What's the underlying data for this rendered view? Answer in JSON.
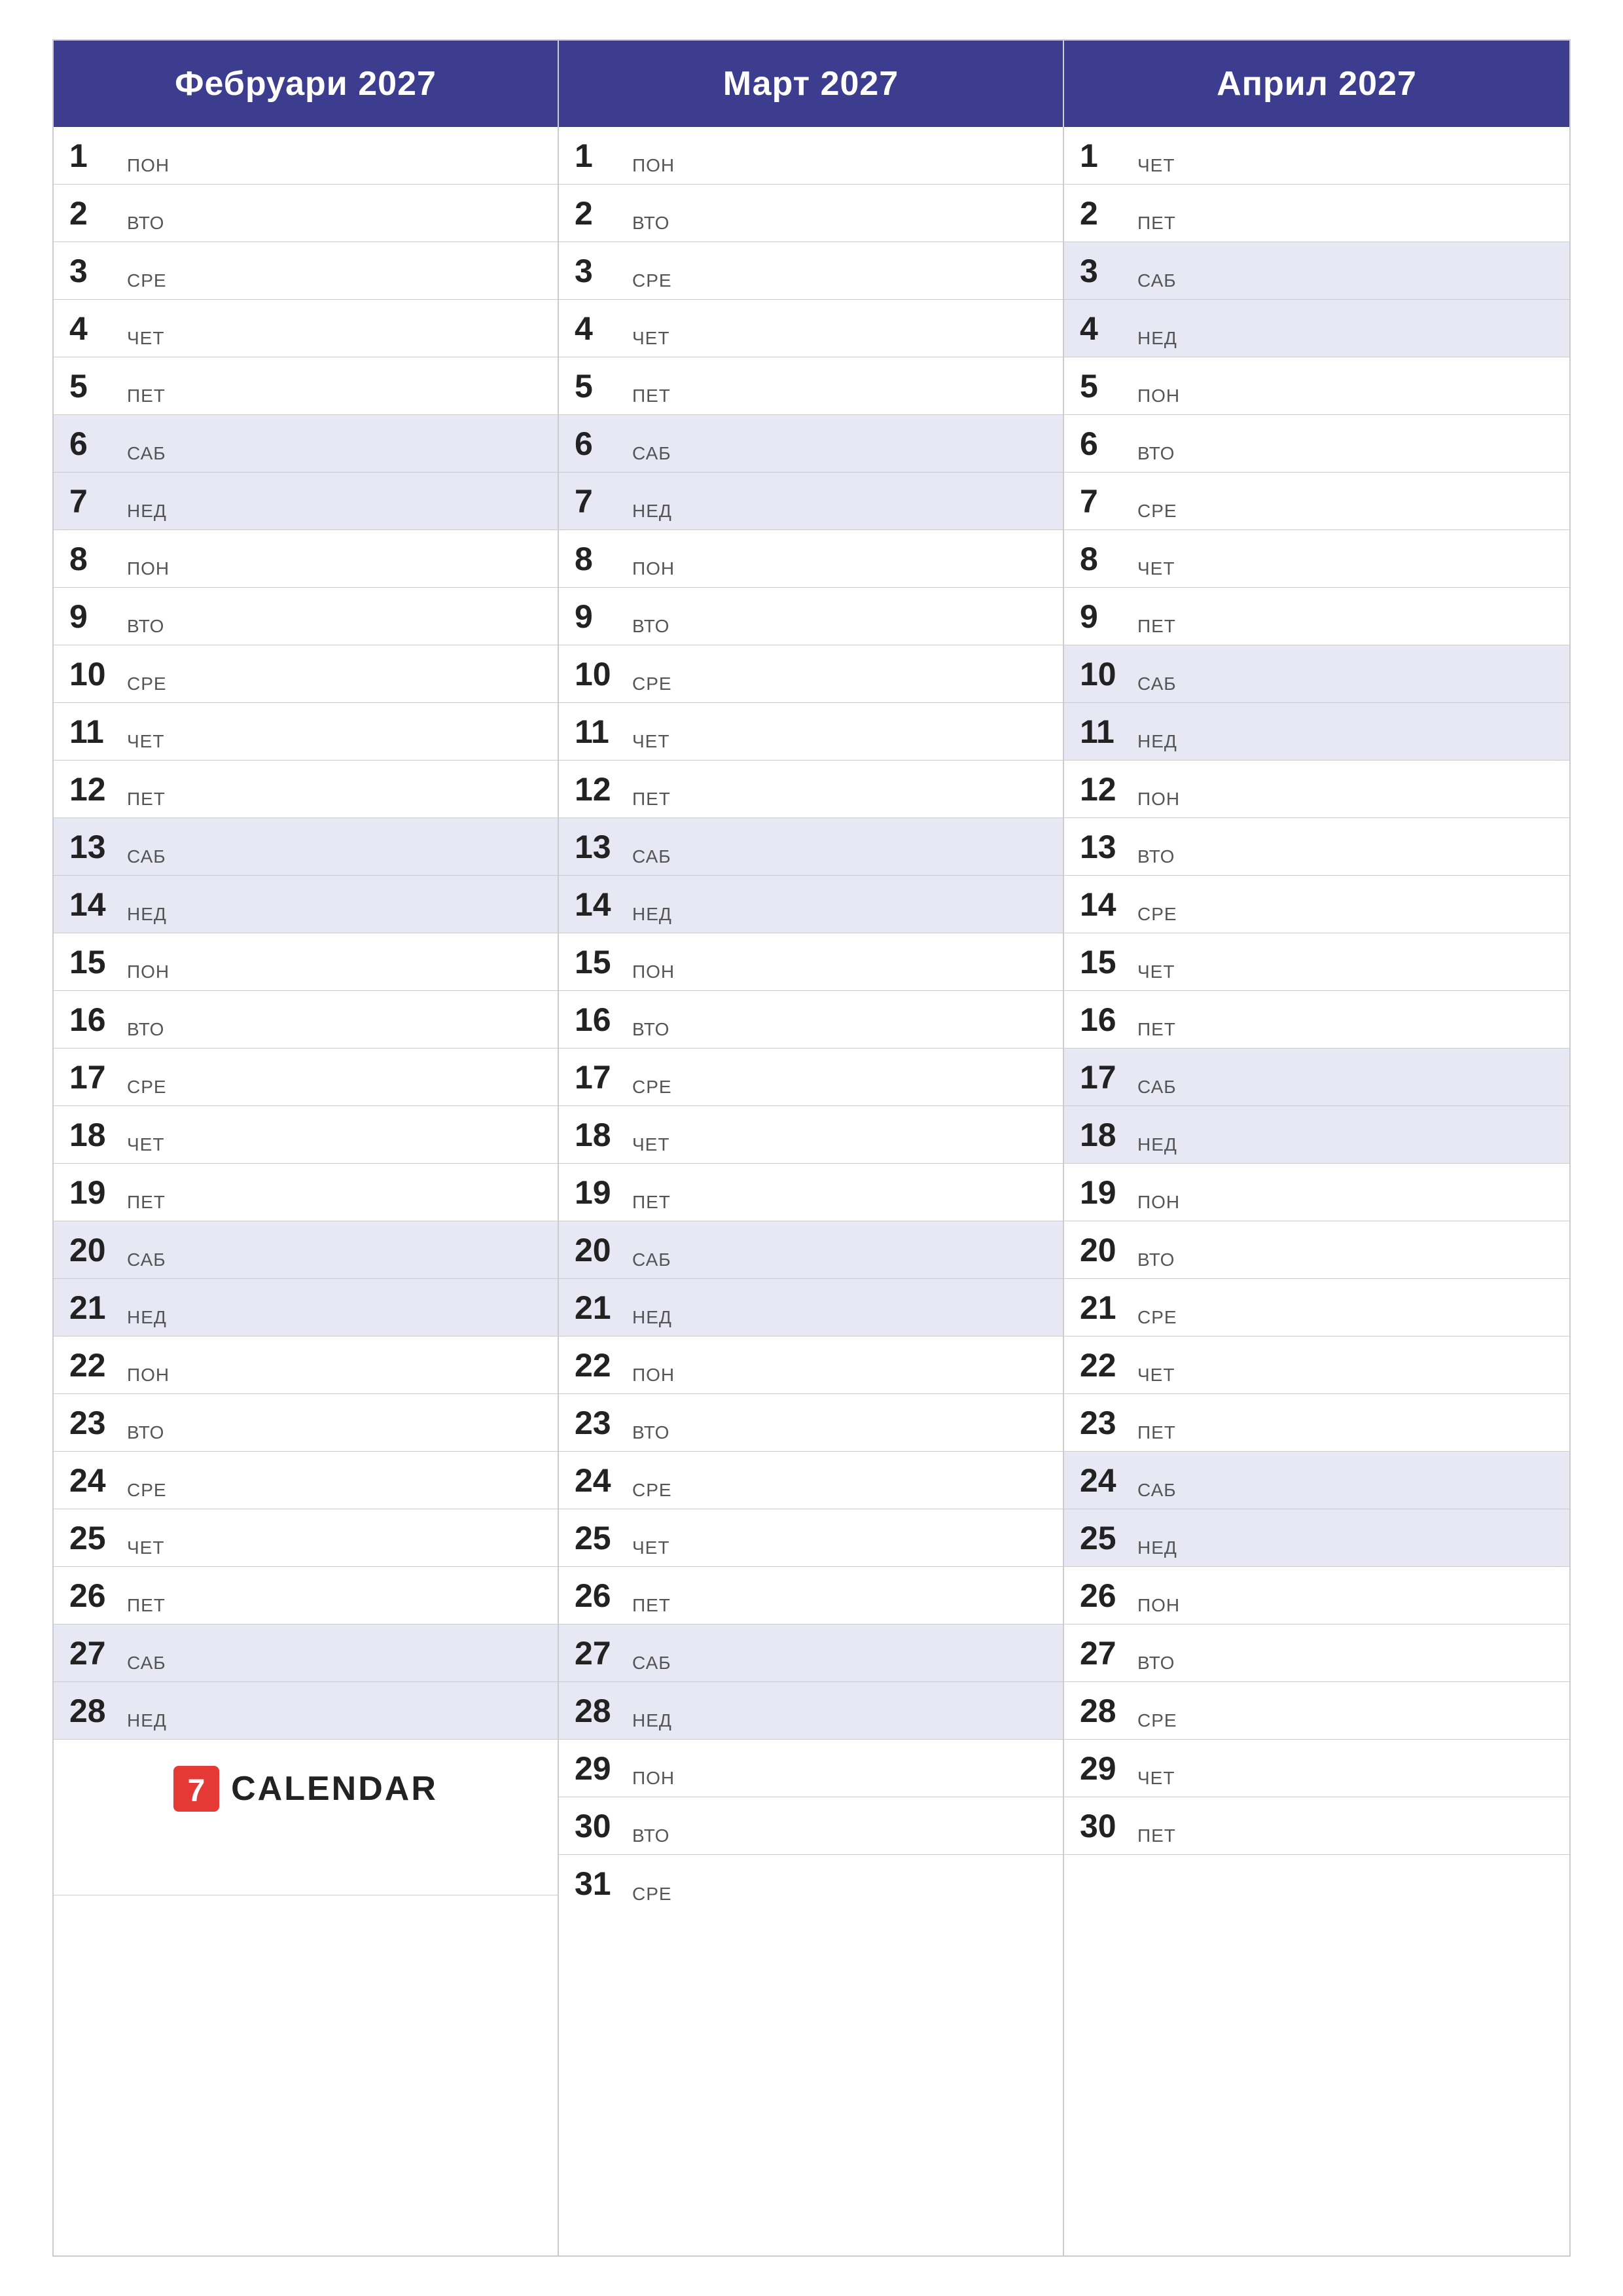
{
  "months": [
    {
      "name": "Фебруари 2027",
      "days": [
        {
          "num": "1",
          "dayName": "ПОН",
          "weekend": false
        },
        {
          "num": "2",
          "dayName": "ВТО",
          "weekend": false
        },
        {
          "num": "3",
          "dayName": "СРЕ",
          "weekend": false
        },
        {
          "num": "4",
          "dayName": "ЧЕТ",
          "weekend": false
        },
        {
          "num": "5",
          "dayName": "ПЕТ",
          "weekend": false
        },
        {
          "num": "6",
          "dayName": "САБ",
          "weekend": true
        },
        {
          "num": "7",
          "dayName": "НЕД",
          "weekend": true
        },
        {
          "num": "8",
          "dayName": "ПОН",
          "weekend": false
        },
        {
          "num": "9",
          "dayName": "ВТО",
          "weekend": false
        },
        {
          "num": "10",
          "dayName": "СРЕ",
          "weekend": false
        },
        {
          "num": "11",
          "dayName": "ЧЕТ",
          "weekend": false
        },
        {
          "num": "12",
          "dayName": "ПЕТ",
          "weekend": false
        },
        {
          "num": "13",
          "dayName": "САБ",
          "weekend": true
        },
        {
          "num": "14",
          "dayName": "НЕД",
          "weekend": true
        },
        {
          "num": "15",
          "dayName": "ПОН",
          "weekend": false
        },
        {
          "num": "16",
          "dayName": "ВТО",
          "weekend": false
        },
        {
          "num": "17",
          "dayName": "СРЕ",
          "weekend": false
        },
        {
          "num": "18",
          "dayName": "ЧЕТ",
          "weekend": false
        },
        {
          "num": "19",
          "dayName": "ПЕТ",
          "weekend": false
        },
        {
          "num": "20",
          "dayName": "САБ",
          "weekend": true
        },
        {
          "num": "21",
          "dayName": "НЕД",
          "weekend": true
        },
        {
          "num": "22",
          "dayName": "ПОН",
          "weekend": false
        },
        {
          "num": "23",
          "dayName": "ВТО",
          "weekend": false
        },
        {
          "num": "24",
          "dayName": "СРЕ",
          "weekend": false
        },
        {
          "num": "25",
          "dayName": "ЧЕТ",
          "weekend": false
        },
        {
          "num": "26",
          "dayName": "ПЕТ",
          "weekend": false
        },
        {
          "num": "27",
          "dayName": "САБ",
          "weekend": true
        },
        {
          "num": "28",
          "dayName": "НЕД",
          "weekend": true
        }
      ],
      "hasLogo": true,
      "extraDays": 3
    },
    {
      "name": "Март 2027",
      "days": [
        {
          "num": "1",
          "dayName": "ПОН",
          "weekend": false
        },
        {
          "num": "2",
          "dayName": "ВТО",
          "weekend": false
        },
        {
          "num": "3",
          "dayName": "СРЕ",
          "weekend": false
        },
        {
          "num": "4",
          "dayName": "ЧЕТ",
          "weekend": false
        },
        {
          "num": "5",
          "dayName": "ПЕТ",
          "weekend": false
        },
        {
          "num": "6",
          "dayName": "САБ",
          "weekend": true
        },
        {
          "num": "7",
          "dayName": "НЕД",
          "weekend": true
        },
        {
          "num": "8",
          "dayName": "ПОН",
          "weekend": false
        },
        {
          "num": "9",
          "dayName": "ВТО",
          "weekend": false
        },
        {
          "num": "10",
          "dayName": "СРЕ",
          "weekend": false
        },
        {
          "num": "11",
          "dayName": "ЧЕТ",
          "weekend": false
        },
        {
          "num": "12",
          "dayName": "ПЕТ",
          "weekend": false
        },
        {
          "num": "13",
          "dayName": "САБ",
          "weekend": true
        },
        {
          "num": "14",
          "dayName": "НЕД",
          "weekend": true
        },
        {
          "num": "15",
          "dayName": "ПОН",
          "weekend": false
        },
        {
          "num": "16",
          "dayName": "ВТО",
          "weekend": false
        },
        {
          "num": "17",
          "dayName": "СРЕ",
          "weekend": false
        },
        {
          "num": "18",
          "dayName": "ЧЕТ",
          "weekend": false
        },
        {
          "num": "19",
          "dayName": "ПЕТ",
          "weekend": false
        },
        {
          "num": "20",
          "dayName": "САБ",
          "weekend": true
        },
        {
          "num": "21",
          "dayName": "НЕД",
          "weekend": true
        },
        {
          "num": "22",
          "dayName": "ПОН",
          "weekend": false
        },
        {
          "num": "23",
          "dayName": "ВТО",
          "weekend": false
        },
        {
          "num": "24",
          "dayName": "СРЕ",
          "weekend": false
        },
        {
          "num": "25",
          "dayName": "ЧЕТ",
          "weekend": false
        },
        {
          "num": "26",
          "dayName": "ПЕТ",
          "weekend": false
        },
        {
          "num": "27",
          "dayName": "САБ",
          "weekend": true
        },
        {
          "num": "28",
          "dayName": "НЕД",
          "weekend": true
        },
        {
          "num": "29",
          "dayName": "ПОН",
          "weekend": false
        },
        {
          "num": "30",
          "dayName": "ВТО",
          "weekend": false
        },
        {
          "num": "31",
          "dayName": "СРЕ",
          "weekend": false
        }
      ],
      "hasLogo": false,
      "extraDays": 0
    },
    {
      "name": "Април 2027",
      "days": [
        {
          "num": "1",
          "dayName": "ЧЕТ",
          "weekend": false
        },
        {
          "num": "2",
          "dayName": "ПЕТ",
          "weekend": false
        },
        {
          "num": "3",
          "dayName": "САБ",
          "weekend": true
        },
        {
          "num": "4",
          "dayName": "НЕД",
          "weekend": true
        },
        {
          "num": "5",
          "dayName": "ПОН",
          "weekend": false
        },
        {
          "num": "6",
          "dayName": "ВТО",
          "weekend": false
        },
        {
          "num": "7",
          "dayName": "СРЕ",
          "weekend": false
        },
        {
          "num": "8",
          "dayName": "ЧЕТ",
          "weekend": false
        },
        {
          "num": "9",
          "dayName": "ПЕТ",
          "weekend": false
        },
        {
          "num": "10",
          "dayName": "САБ",
          "weekend": true
        },
        {
          "num": "11",
          "dayName": "НЕД",
          "weekend": true
        },
        {
          "num": "12",
          "dayName": "ПОН",
          "weekend": false
        },
        {
          "num": "13",
          "dayName": "ВТО",
          "weekend": false
        },
        {
          "num": "14",
          "dayName": "СРЕ",
          "weekend": false
        },
        {
          "num": "15",
          "dayName": "ЧЕТ",
          "weekend": false
        },
        {
          "num": "16",
          "dayName": "ПЕТ",
          "weekend": false
        },
        {
          "num": "17",
          "dayName": "САБ",
          "weekend": true
        },
        {
          "num": "18",
          "dayName": "НЕД",
          "weekend": true
        },
        {
          "num": "19",
          "dayName": "ПОН",
          "weekend": false
        },
        {
          "num": "20",
          "dayName": "ВТО",
          "weekend": false
        },
        {
          "num": "21",
          "dayName": "СРЕ",
          "weekend": false
        },
        {
          "num": "22",
          "dayName": "ЧЕТ",
          "weekend": false
        },
        {
          "num": "23",
          "dayName": "ПЕТ",
          "weekend": false
        },
        {
          "num": "24",
          "dayName": "САБ",
          "weekend": true
        },
        {
          "num": "25",
          "dayName": "НЕД",
          "weekend": true
        },
        {
          "num": "26",
          "dayName": "ПОН",
          "weekend": false
        },
        {
          "num": "27",
          "dayName": "ВТО",
          "weekend": false
        },
        {
          "num": "28",
          "dayName": "СРЕ",
          "weekend": false
        },
        {
          "num": "29",
          "dayName": "ЧЕТ",
          "weekend": false
        },
        {
          "num": "30",
          "dayName": "ПЕТ",
          "weekend": false
        }
      ],
      "hasLogo": false,
      "extraDays": 1
    }
  ],
  "logo": {
    "text": "CALENDAR",
    "icon_color": "#e53935"
  }
}
